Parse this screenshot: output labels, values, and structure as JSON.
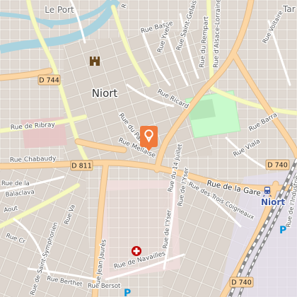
{
  "map": {
    "city": "Niort",
    "station_name": "Niort",
    "districts": [
      "Le Port",
      "Tar"
    ],
    "roads": {
      "d744": "D 744",
      "d811": "D 811",
      "d740_a": "D 740",
      "d740_b": "D 740"
    },
    "streets": {
      "rue_de_la_gare": "Rue de la Gare",
      "rue_de_ribray": "Rue de Ribray",
      "rue_chabaudy": "Rue Chabaudy",
      "rue_du_palais": "Rue du Palais",
      "rue_mellaise": "Rue Mellaise",
      "rue_ricard": "Rue Ricard",
      "rue_basse": "Rue Basse",
      "rue_yver": "Rue Yver",
      "rue_saint_gelais": "Rue Saint-Gelais",
      "rue_du_rempart": "Rue du Rempart",
      "rue_alsace_lorraine": "Rue d'Alsace-Lorraine",
      "rue_voltaire": "Rue Voltaire",
      "rue_barra": "Rue Barra",
      "rue_viala": "Rue Viala",
      "rue_de_l_yser": "Rue de l'Yser",
      "rue_du_14_juillet": "Rue du 14 Juillet",
      "rue_des_trois_coigneaux": "Rue des Trois Coigneaux",
      "rue_de_l_industrie": "Rue de l'Industrie",
      "rue_jean_jaures": "Rue Jean Jaurès",
      "rue_de_navailles": "Rue de Navailles",
      "rue_bersot": "Rue Bersot",
      "rue_berthet": "Rue Berthet",
      "rue_de_saint_symphorien": "Rue de Saint-Symphorien",
      "rue_balaclava": "Balaclava",
      "rue_aout": "Aout",
      "rue_de_la": "Rue de la",
      "rue_cr": "Rue Cr",
      "rue_val": "Rue Va",
      "rue_r": "R"
    },
    "colors": {
      "background": "#f2efe9",
      "building": "#d9d0c9",
      "primary_road": "#fcd6a4",
      "secondary_road": "#f7fabf",
      "water": "#aad3df",
      "park": "#c8facc",
      "rail": "#8a8a8a",
      "marker": "#f07a3c",
      "hospital": "#bf0000",
      "parking": "#0092da"
    },
    "pois": {
      "castle_icon": "castle-icon",
      "marker_icon": "location-marker-icon",
      "hospital_icon": "hospital-icon",
      "parking_icon": "parking-icon",
      "parking_letter": "P",
      "train_icon": "train-icon"
    }
  }
}
